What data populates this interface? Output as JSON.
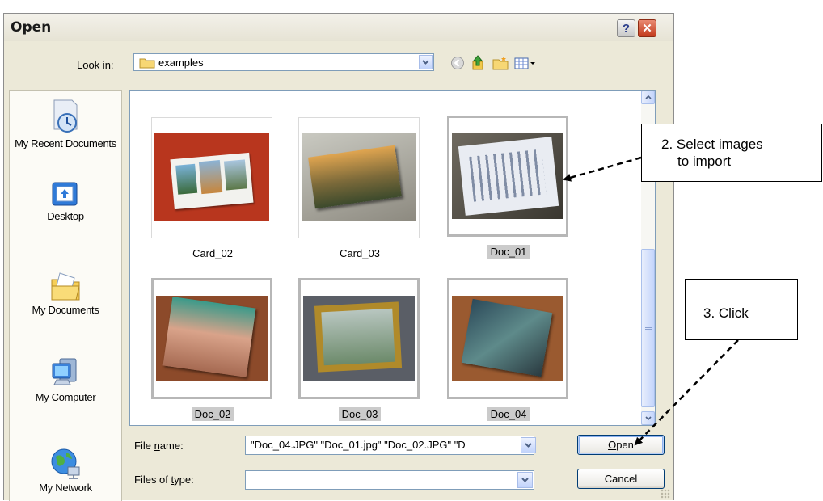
{
  "dialog": {
    "title": "Open",
    "help_glyph": "?",
    "close_glyph": "✕"
  },
  "lookin": {
    "label": "Look in:",
    "value": "examples"
  },
  "places": [
    {
      "label": "My Recent Documents",
      "icon": "recent-documents-icon"
    },
    {
      "label": "Desktop",
      "icon": "desktop-icon"
    },
    {
      "label": "My Documents",
      "icon": "my-documents-icon"
    },
    {
      "label": "My Computer",
      "icon": "my-computer-icon"
    },
    {
      "label": "My Network",
      "icon": "my-network-icon"
    }
  ],
  "files": [
    {
      "name": "Card_02",
      "selected": false
    },
    {
      "name": "Card_03",
      "selected": false
    },
    {
      "name": "Doc_01",
      "selected": true
    },
    {
      "name": "Doc_02",
      "selected": true
    },
    {
      "name": "Doc_03",
      "selected": true
    },
    {
      "name": "Doc_04",
      "selected": true
    }
  ],
  "filename": {
    "label_pre": "File ",
    "label_key": "n",
    "label_post": "ame:",
    "value": "\"Doc_04.JPG\" \"Doc_01.jpg\" \"Doc_02.JPG\" \"D"
  },
  "filetype": {
    "label_pre": "Files of ",
    "label_key": "t",
    "label_post": "ype:",
    "value": ""
  },
  "buttons": {
    "open_key": "O",
    "open_rest": "pen",
    "cancel": "Cancel"
  },
  "annotations": {
    "select_line1": "2. Select images",
    "select_line2": "to import",
    "click": "3. Click"
  }
}
